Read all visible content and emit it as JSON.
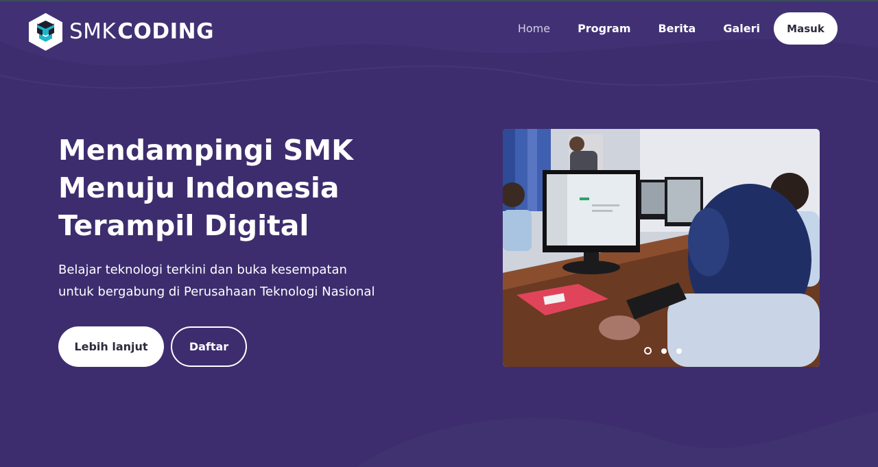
{
  "brand": {
    "name_part1": "SMK",
    "name_part2": "CODING",
    "colors": {
      "background": "#3d2d6e",
      "logo_accent": "#1bb5c9",
      "button_text": "#2b2b3d"
    }
  },
  "nav": {
    "items": [
      {
        "label": "Home",
        "active": true
      },
      {
        "label": "Program",
        "active": false
      },
      {
        "label": "Berita",
        "active": false
      },
      {
        "label": "Galeri",
        "active": false
      }
    ],
    "login_label": "Masuk"
  },
  "hero": {
    "title_lines": [
      "Mendampingi SMK",
      "Menuju Indonesia",
      "Terampil Digital"
    ],
    "subtitle_lines": [
      "Belajar teknologi terkini dan buka kesempatan",
      "untuk bergabung di Perusahaan Teknologi Nasional"
    ],
    "primary_button": "Lebih lanjut",
    "secondary_button": "Daftar"
  },
  "carousel": {
    "slide_count": 3,
    "active_index": 0
  }
}
